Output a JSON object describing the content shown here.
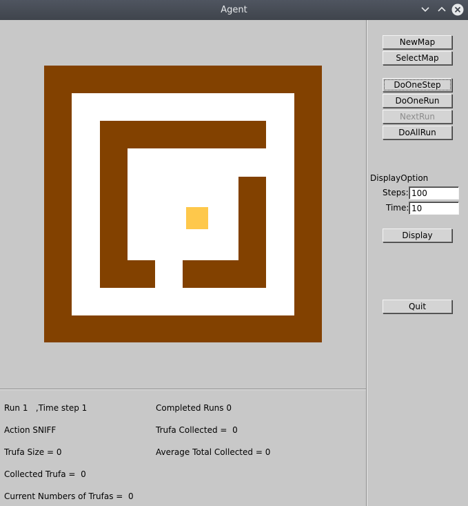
{
  "window": {
    "title": "Agent"
  },
  "map": {
    "wall_color": "#824100",
    "floor_color": "#ffffff",
    "trufa_color": "#fec84b"
  },
  "status": {
    "run_line": "Run 1   ,Time step 1",
    "action_line": "Action SNIFF",
    "trufa_size_line": "Trufa Size = 0",
    "collected_trufa_line": "Collected Trufa =  0",
    "current_trufas_line": "Current Numbers of Trufas =  0",
    "completed_runs_line": "Completed Runs 0",
    "trufa_collected_line": "Trufa Collected =  0",
    "average_total_line": "Average Total Collected = 0"
  },
  "controls": {
    "new_map": "NewMap",
    "select_map": "SelectMap",
    "do_one_step": "DoOneStep",
    "do_one_run": "DoOneRun",
    "next_run": "NextRun",
    "do_all_run": "DoAllRun",
    "display_option_label": "DisplayOption",
    "steps_label": "Steps:",
    "steps_value": "100",
    "time_label": "Time:",
    "time_value": "10",
    "display": "Display",
    "quit": "Quit"
  }
}
